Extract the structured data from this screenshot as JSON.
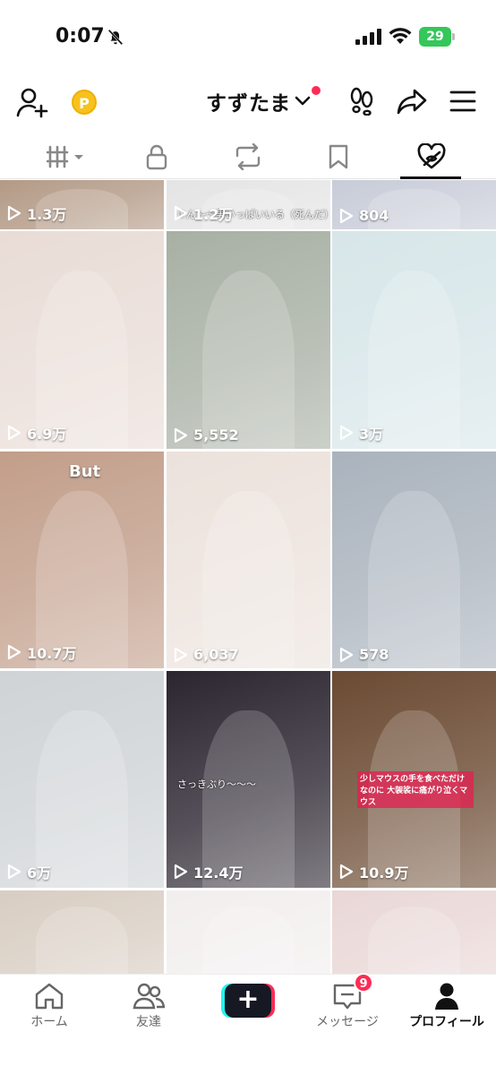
{
  "status_bar": {
    "time": "0:07",
    "battery": "29"
  },
  "header": {
    "username": "すずたま",
    "coin_label": "P"
  },
  "tabs": [
    {
      "id": "videos",
      "icon": "grid-icon",
      "active": false
    },
    {
      "id": "private",
      "icon": "lock-icon",
      "active": false
    },
    {
      "id": "reposts",
      "icon": "repost-icon",
      "active": false
    },
    {
      "id": "favorites",
      "icon": "bookmark-icon",
      "active": false
    },
    {
      "id": "liked",
      "icon": "heart-hidden-icon",
      "active": true
    }
  ],
  "grid": {
    "tiles": [
      {
        "views": "1.3万",
        "bg": "#b39a86"
      },
      {
        "views": "1.2万",
        "bg": "#e4e4e4",
        "overlay": "①ん〜〜男いっぱいいる（死んだ）"
      },
      {
        "views": "804",
        "bg": "#c8ccd8"
      },
      {
        "views": "6.9万",
        "bg": "#e9dcd6"
      },
      {
        "views": "5,552",
        "bg": "#a8b0a4"
      },
      {
        "views": "3万",
        "bg": "#d7e6e9"
      },
      {
        "views": "10.7万",
        "bg": "#c29e8a",
        "caption": "But"
      },
      {
        "views": "6,037",
        "bg": "#ece2dc"
      },
      {
        "views": "578",
        "bg": "#aab3bd"
      },
      {
        "views": "6万",
        "bg": "#cfd3d6"
      },
      {
        "views": "12.4万",
        "bg": "#2b2530",
        "overlay": "さっきぶり〜〜〜"
      },
      {
        "views": "10.9万",
        "bg": "#6b4a32",
        "redtext": "少しマウスの手を食べただけなのに 大袈裟に痛がり泣くマウス"
      },
      {
        "views": "",
        "bg": "#d8cdc2"
      },
      {
        "views": "",
        "bg": "#f2eeee"
      },
      {
        "views": "",
        "bg": "#e9d7d6"
      }
    ]
  },
  "bottom_nav": {
    "items": [
      {
        "label": "ホーム",
        "icon": "home-icon"
      },
      {
        "label": "友達",
        "icon": "friends-icon"
      },
      {
        "label": "",
        "icon": "create-icon"
      },
      {
        "label": "メッセージ",
        "icon": "inbox-icon"
      },
      {
        "label": "プロフィール",
        "icon": "profile-icon"
      }
    ],
    "inbox_badge": "9"
  },
  "colors": {
    "accent": "#fe2c55",
    "cyan": "#25f4ee",
    "battery": "#34c759",
    "coin": "#f7c21d"
  }
}
